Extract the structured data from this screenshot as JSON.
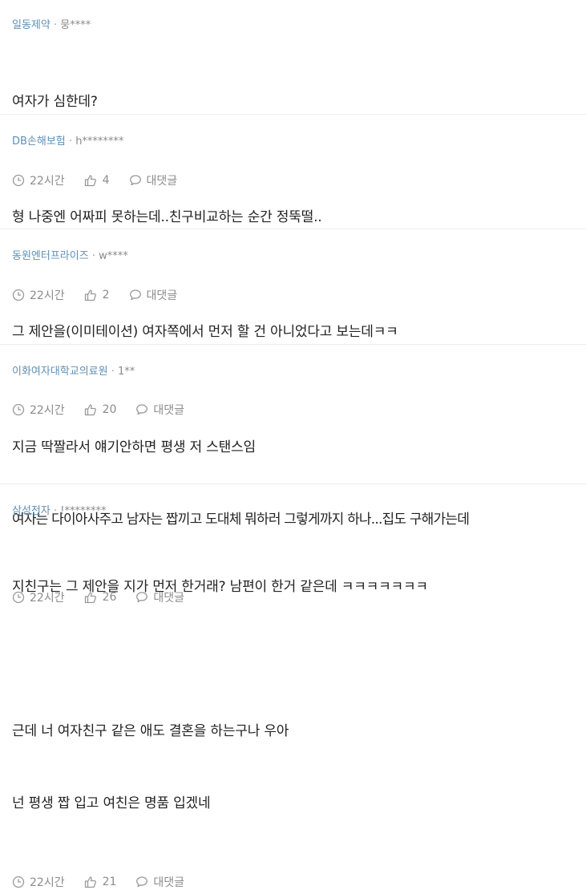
{
  "comments": [
    {
      "company": "일동제약",
      "user": "뭉****",
      "lines": [
        "여자가 심한데?"
      ],
      "time": "22시간",
      "likes": "4",
      "reply": "대댓글"
    },
    {
      "company": "DB손해보험",
      "user": "h********",
      "lines": [
        "형 나중엔 어짜피 못하는데..친구비교하는 순간 정뚝떨.."
      ],
      "time": "22시간",
      "likes": "2",
      "reply": "대댓글"
    },
    {
      "company": "동원엔터프라이즈",
      "user": "w****",
      "lines": [
        "그 제안을(이미테이션) 여자쪽에서 먼저 할 건 아니었다고 보는데ㅋㅋ"
      ],
      "time": "22시간",
      "likes": "20",
      "reply": "대댓글"
    },
    {
      "company": "이화여자대학교의료원",
      "user": "1**",
      "lines": [
        "지금 딱짤라서 얘기안하면 평생 저 스탠스임",
        "여자는 다이아사주고 남자는 짭끼고 도대체 뭐하러 그렇게까지 하나...집도 구해가는데"
      ],
      "time": "22시간",
      "likes": "26",
      "reply": "대댓글"
    },
    {
      "company": "삼성전자",
      "user": "!********",
      "lines": [
        "지친구는 그 제안을 지가 먼저 한거래? 남편이 한거 같은데 ㅋㅋㅋㅋㅋㅋㅋ",
        "",
        "근데 너 여자친구 같은 애도 결혼을 하는구나 우아",
        "넌 평생 짭 입고 여친은 명품 입겠네"
      ],
      "time": "22시간",
      "likes": "21",
      "reply": "대댓글"
    }
  ]
}
